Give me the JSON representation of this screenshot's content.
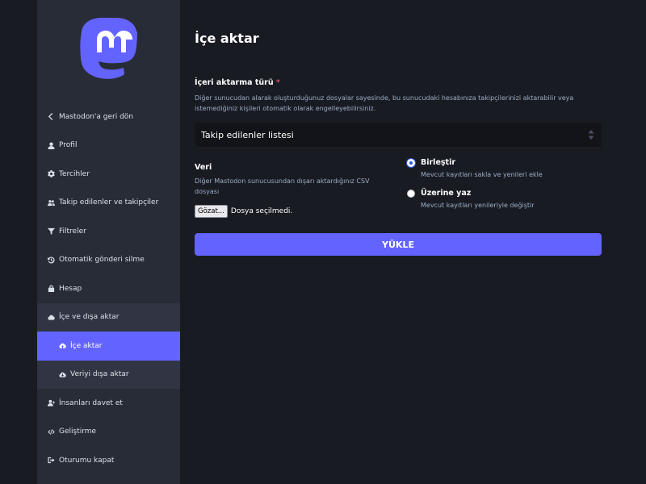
{
  "sidebar": {
    "logo": "mastodon-logo",
    "items": [
      {
        "label": "Mastodon'a geri dön",
        "icon": "chevron-left-icon"
      },
      {
        "label": "Profil",
        "icon": "user-icon"
      },
      {
        "label": "Tercihler",
        "icon": "gear-icon"
      },
      {
        "label": "Takip edilenler ve takipçiler",
        "icon": "users-icon"
      },
      {
        "label": "Filtreler",
        "icon": "filter-icon"
      },
      {
        "label": "Otomatik gönderi silme",
        "icon": "history-icon"
      },
      {
        "label": "Hesap",
        "icon": "lock-icon"
      },
      {
        "label": "İçe ve dışa aktar",
        "icon": "cloud-icon"
      },
      {
        "label": "İçe aktar",
        "icon": "cloud-upload-icon"
      },
      {
        "label": "Veriyi dışa aktar",
        "icon": "cloud-download-icon"
      },
      {
        "label": "İnsanları davet et",
        "icon": "user-plus-icon"
      },
      {
        "label": "Geliştirme",
        "icon": "code-icon"
      },
      {
        "label": "Oturumu kapat",
        "icon": "sign-out-icon"
      }
    ]
  },
  "main": {
    "title": "İçe aktar",
    "import_type": {
      "label": "İçeri aktarma türü",
      "required_mark": "*",
      "hint": "Diğer sunucudan alarak oluşturduğunuz dosyalar sayesinde, bu sunucudaki hesabınıza takipçilerinizi aktarabilir veya istemediğiniz kişileri otomatik olarak engelleyebilirsiniz.",
      "selected": "Takip edilenler listesi"
    },
    "data": {
      "label": "Veri",
      "hint": "Diğer Mastodon sunucusundan dışarı aktardığınız CSV dosyası",
      "browse_label": "Gözat...",
      "file_status": "Dosya seçilmedi."
    },
    "mode": {
      "options": [
        {
          "label": "Birleştir",
          "hint": "Mevcut kayıtları sakla ve yenileri ekle",
          "checked": true
        },
        {
          "label": "Üzerine yaz",
          "hint": "Mevcut kayıtları yenileriyle değiştir",
          "checked": false
        }
      ]
    },
    "submit_label": "YÜKLE"
  },
  "colors": {
    "background": "#191b22",
    "sidebar": "#282c37",
    "accent": "#6364ff",
    "hint_text": "#9baec8",
    "required": "#df405a"
  }
}
